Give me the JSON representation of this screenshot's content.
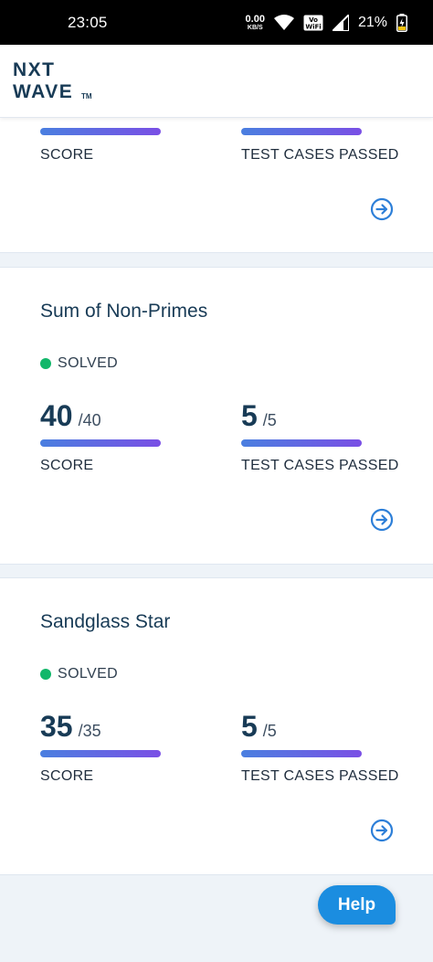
{
  "status_bar": {
    "time": "23:05",
    "net_speed_value": "0.00",
    "net_speed_unit": "KB/S",
    "network_label": "Vo WiFi",
    "battery": "21%"
  },
  "header": {
    "logo_line1": "NXT",
    "logo_line2": "WAVE",
    "logo_tm": "TM",
    "icons": [
      "stopwatch-icon",
      "chat-icon",
      "menu-icon"
    ],
    "notification_color": "#e0362a"
  },
  "cards": [
    {
      "title": "",
      "status": "",
      "score": "",
      "score_total": "",
      "cases": "",
      "cases_total": "",
      "score_label": "SCORE",
      "cases_label": "TEST CASES PASSED"
    },
    {
      "title": "Sum of Non-Primes",
      "status": "SOLVED",
      "score": "40",
      "score_total": "/40",
      "cases": "5",
      "cases_total": "/5",
      "score_label": "SCORE",
      "cases_label": "TEST CASES PASSED"
    },
    {
      "title": "Sandglass Star",
      "status": "SOLVED",
      "score": "35",
      "score_total": "/35",
      "cases": "5",
      "cases_total": "/5",
      "score_label": "SCORE",
      "cases_label": "TEST CASES PASSED"
    }
  ],
  "help": {
    "label": "Help"
  },
  "colors": {
    "primary_text": "#183b56",
    "solved_dot": "#12b76a",
    "bar_start": "#4a7fe0",
    "bar_end": "#7a4fe5",
    "help_button": "#1b8de0"
  }
}
